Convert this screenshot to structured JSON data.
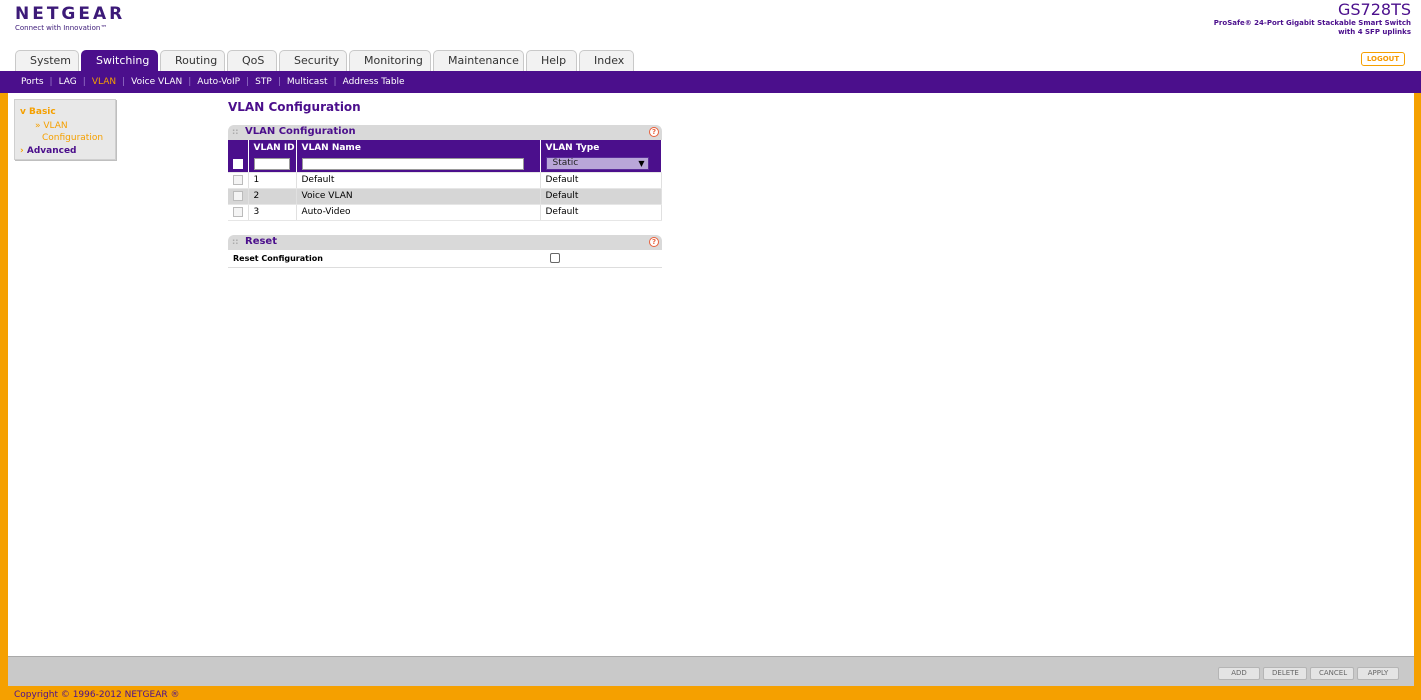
{
  "header": {
    "brand": "NETGEAR",
    "tagline": "Connect with Innovation™",
    "model": "GS728TS",
    "model_desc_1": "ProSafe® 24-Port Gigabit Stackable Smart Switch",
    "model_desc_2": "with 4 SFP uplinks",
    "logout_label": "LOGOUT"
  },
  "tabs": [
    {
      "label": "System"
    },
    {
      "label": "Switching"
    },
    {
      "label": "Routing"
    },
    {
      "label": "QoS"
    },
    {
      "label": "Security"
    },
    {
      "label": "Monitoring"
    },
    {
      "label": "Maintenance"
    },
    {
      "label": "Help"
    },
    {
      "label": "Index"
    }
  ],
  "subnav": [
    {
      "label": "Ports"
    },
    {
      "label": "LAG"
    },
    {
      "label": "VLAN"
    },
    {
      "label": "Voice VLAN"
    },
    {
      "label": "Auto-VoIP"
    },
    {
      "label": "STP"
    },
    {
      "label": "Multicast"
    },
    {
      "label": "Address Table"
    }
  ],
  "leftnav": {
    "basic": "Basic",
    "basic_arrow": "v",
    "sub_item_1": "» VLAN",
    "sub_item_2": "Configuration",
    "advanced": "Advanced",
    "advanced_arrow": "›"
  },
  "page_title": "VLAN Configuration",
  "vlan_section": {
    "title": "VLAN Configuration",
    "help": "?",
    "grip": "::",
    "columns": [
      "VLAN ID",
      "VLAN Name",
      "VLAN Type"
    ],
    "type_select_value": "Static",
    "rows": [
      {
        "id": "1",
        "name": "Default",
        "type": "Default"
      },
      {
        "id": "2",
        "name": "Voice VLAN",
        "type": "Default"
      },
      {
        "id": "3",
        "name": "Auto-Video",
        "type": "Default"
      }
    ]
  },
  "reset_section": {
    "title": "Reset",
    "help": "?",
    "grip": "::",
    "label": "Reset Configuration"
  },
  "buttons": {
    "add": "ADD",
    "delete": "DELETE",
    "cancel": "CANCEL",
    "apply": "APPLY"
  },
  "footer": {
    "copyright": "Copyright © 1996-2012 NETGEAR ®"
  }
}
